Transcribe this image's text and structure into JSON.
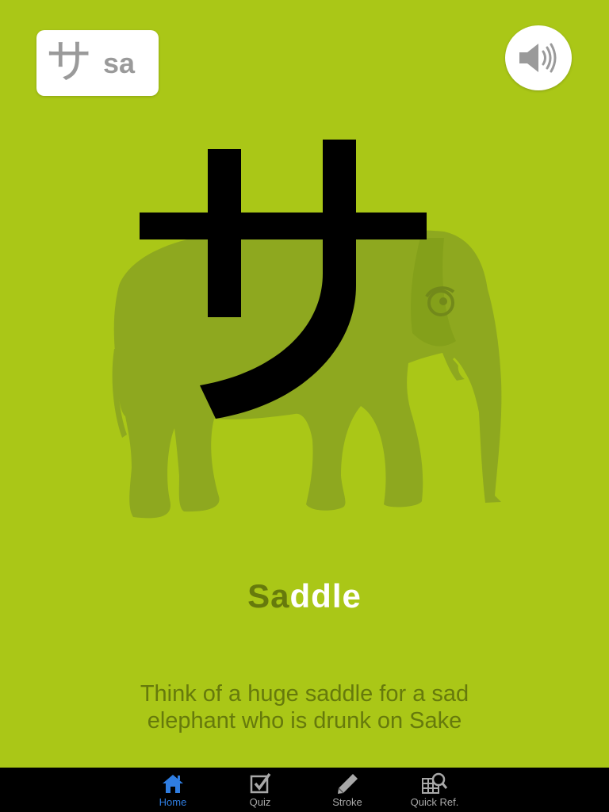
{
  "badge": {
    "kana": "サ",
    "romaji": "sa"
  },
  "sound_button": {
    "icon": "speaker-icon"
  },
  "illustration": {
    "kana": "サ",
    "picture": "elephant"
  },
  "mnemonic": {
    "word_highlight": "Sa",
    "word_rest": "ddle",
    "description_line1": "Think of a huge saddle for a sad",
    "description_line2": "elephant who is drunk on Sake"
  },
  "tabs": [
    {
      "label": "Home",
      "icon": "home-icon",
      "active": true
    },
    {
      "label": "Quiz",
      "icon": "checkbox-icon",
      "active": false
    },
    {
      "label": "Stroke",
      "icon": "pencil-icon",
      "active": false
    },
    {
      "label": "Quick Ref.",
      "icon": "grid-search-icon",
      "active": false
    }
  ],
  "colors": {
    "background": "#aac717",
    "elephant": "#8ea81f",
    "highlight": "#667a0c",
    "tab_active": "#2f7de1",
    "tab_inactive": "#a8a8a8"
  }
}
